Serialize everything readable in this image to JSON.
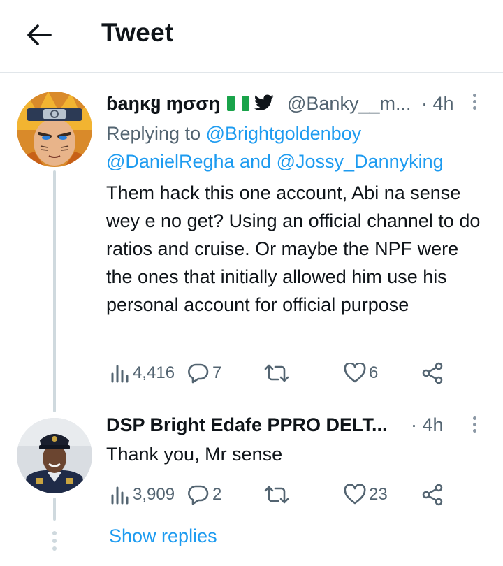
{
  "header": {
    "title": "Tweet",
    "back_icon": "arrow-left-icon"
  },
  "colors": {
    "accent": "#1d9bf0",
    "text": "#0f1419",
    "muted": "#536471",
    "divider": "#e1e6ea"
  },
  "tweets": [
    {
      "display_name": "ɓaŋκყ ɱσσŋ",
      "name_badges": [
        "nigeria-flag-icon",
        "twitter-bird-icon"
      ],
      "handle": "@Banky__m...",
      "time": "· 4h",
      "replying_prefix": "Replying to",
      "replying_to_1": "@Brightgoldenboy",
      "replying_to_2": "@DanielRegha",
      "replying_and": "and",
      "replying_to_3": "@Jossy_Dannyking",
      "text": "Them hack this one account, Abi na sense wey e no get? Using an official channel to do ratios and cruise. Or maybe the NPF were the ones that initially allowed him use his personal account for official purpose",
      "views": "4,416",
      "replies": "7",
      "retweets": "",
      "likes": "6"
    },
    {
      "display_name": "DSP Bright Edafe PPRO DELT...",
      "time": "· 4h",
      "text": "Thank you, Mr sense",
      "views": "3,909",
      "replies": "2",
      "retweets": "",
      "likes": "23"
    }
  ],
  "show_replies": "Show replies"
}
